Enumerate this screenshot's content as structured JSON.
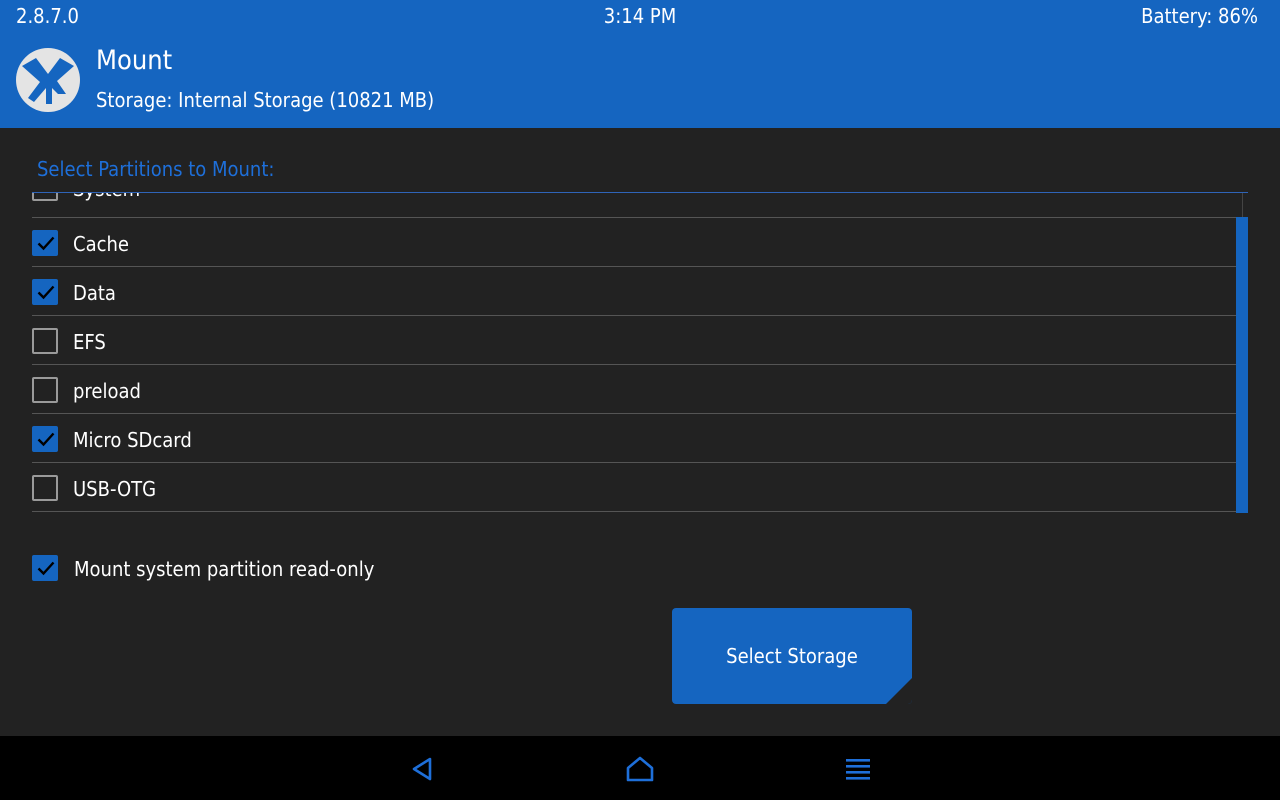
{
  "status_bar": {
    "version": "2.8.7.0",
    "time": "3:14 PM",
    "battery": "Battery: 86%"
  },
  "header": {
    "title": "Mount",
    "subtitle": "Storage: Internal Storage (10821 MB)",
    "logo_icon": "twrp-logo-icon"
  },
  "partitions": {
    "label": "Select Partitions to Mount:",
    "items": [
      {
        "label": "System",
        "checked": false
      },
      {
        "label": "Cache",
        "checked": true
      },
      {
        "label": "Data",
        "checked": true
      },
      {
        "label": "EFS",
        "checked": false
      },
      {
        "label": "preload",
        "checked": false
      },
      {
        "label": "Micro SDcard",
        "checked": true
      },
      {
        "label": "USB-OTG",
        "checked": false
      }
    ]
  },
  "readonly": {
    "label": "Mount system partition read-only",
    "checked": true
  },
  "select_storage": {
    "label": "Select Storage"
  },
  "navbar": {
    "icons": [
      "back-icon",
      "home-icon",
      "menu-icon"
    ]
  },
  "colors": {
    "accent": "#1565c0",
    "background": "#222222",
    "navbar": "#000000",
    "label_accent": "#1e6fd9"
  }
}
